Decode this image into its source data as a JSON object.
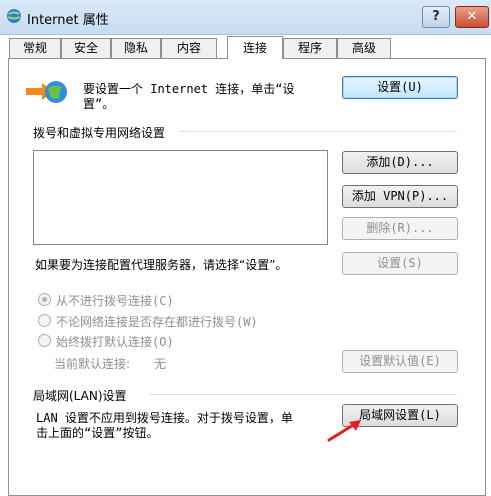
{
  "window": {
    "title": "Internet 属性",
    "help_label": "?",
    "close_label": "✕"
  },
  "tabs": [
    {
      "label": "常规"
    },
    {
      "label": "安全"
    },
    {
      "label": "隐私"
    },
    {
      "label": "内容"
    },
    {
      "label": "连接",
      "active": true
    },
    {
      "label": "程序"
    },
    {
      "label": "高级"
    }
  ],
  "setup": {
    "text_line1": "要设置一个 Internet 连接，单击“设",
    "text_line2": "置”。",
    "button": "设置(U)"
  },
  "dialup": {
    "group_label": "拨号和虚拟专用网络设置",
    "add_button": "添加(D)...",
    "add_vpn_button": "添加 VPN(P)...",
    "delete_button": "删除(R)...",
    "proxy_text": "如果要为连接配置代理服务器，请选择“设置”。",
    "settings_button": "设置(S)",
    "options": [
      {
        "label": "从不进行拨号连接(C)",
        "checked": true
      },
      {
        "label": "不论网络连接是否存在都进行拨号(W)",
        "checked": false
      },
      {
        "label": "始终拨打默认连接(O)",
        "checked": false
      }
    ],
    "current_default_label": "当前默认连接:",
    "current_default_value": "无",
    "set_default_button": "设置默认值(E)"
  },
  "lan": {
    "group_label": "局域网(LAN)设置",
    "text_line1": "LAN 设置不应用到拨号连接。对于拨号设置，单",
    "text_line2": "击上面的“设置”按钮。",
    "button": "局域网设置(L)"
  },
  "colors": {
    "annotation_arrow": "#e02020"
  }
}
